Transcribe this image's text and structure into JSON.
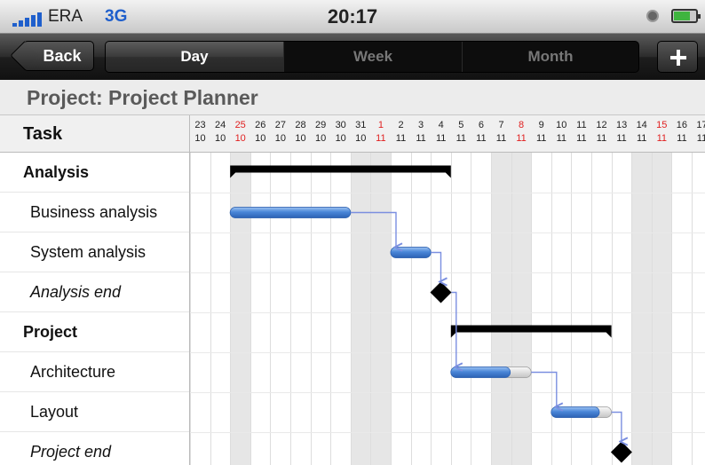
{
  "status_bar": {
    "carrier": "ERA",
    "network": "3G",
    "time": "20:17",
    "icons": [
      "signal-icon",
      "alarm-icon",
      "battery-icon"
    ]
  },
  "navbar": {
    "back_label": "Back",
    "segments": [
      {
        "label": "Day",
        "selected": true
      },
      {
        "label": "Week",
        "selected": false
      },
      {
        "label": "Month",
        "selected": false
      }
    ],
    "add_icon": "plus-icon"
  },
  "project": {
    "title": "Project: Project Planner"
  },
  "task_header": "Task",
  "tasks": [
    {
      "label": "Analysis",
      "style": "group"
    },
    {
      "label": "Business analysis",
      "style": "task"
    },
    {
      "label": "System analysis",
      "style": "task"
    },
    {
      "label": "Analysis end",
      "style": "milestone"
    },
    {
      "label": "Project",
      "style": "group"
    },
    {
      "label": "Architecture",
      "style": "task"
    },
    {
      "label": "Layout",
      "style": "task"
    },
    {
      "label": "Project end",
      "style": "milestone"
    }
  ],
  "timeline": {
    "days": [
      {
        "day": "23",
        "month": "10",
        "weekend": false
      },
      {
        "day": "24",
        "month": "10",
        "weekend": false
      },
      {
        "day": "25",
        "month": "10",
        "weekend": true,
        "holiday": true
      },
      {
        "day": "26",
        "month": "10",
        "weekend": false
      },
      {
        "day": "27",
        "month": "10",
        "weekend": false
      },
      {
        "day": "28",
        "month": "10",
        "weekend": false
      },
      {
        "day": "29",
        "month": "10",
        "weekend": false
      },
      {
        "day": "30",
        "month": "10",
        "weekend": false
      },
      {
        "day": "31",
        "month": "10",
        "weekend": true
      },
      {
        "day": "1",
        "month": "11",
        "weekend": true,
        "holiday": true
      },
      {
        "day": "2",
        "month": "11",
        "weekend": false
      },
      {
        "day": "3",
        "month": "11",
        "weekend": false
      },
      {
        "day": "4",
        "month": "11",
        "weekend": false
      },
      {
        "day": "5",
        "month": "11",
        "weekend": false
      },
      {
        "day": "6",
        "month": "11",
        "weekend": false
      },
      {
        "day": "7",
        "month": "11",
        "weekend": true
      },
      {
        "day": "8",
        "month": "11",
        "weekend": true,
        "holiday": true
      },
      {
        "day": "9",
        "month": "11",
        "weekend": false
      },
      {
        "day": "10",
        "month": "11",
        "weekend": false
      },
      {
        "day": "11",
        "month": "11",
        "weekend": false
      },
      {
        "day": "12",
        "month": "11",
        "weekend": false
      },
      {
        "day": "13",
        "month": "11",
        "weekend": false
      },
      {
        "day": "14",
        "month": "11",
        "weekend": true
      },
      {
        "day": "15",
        "month": "11",
        "weekend": true,
        "holiday": true
      },
      {
        "day": "16",
        "month": "11",
        "weekend": false
      },
      {
        "day": "17",
        "month": "11",
        "weekend": false
      }
    ],
    "bars": [
      {
        "row": 0,
        "type": "summary",
        "start": 2,
        "end": 13
      },
      {
        "row": 1,
        "type": "task",
        "start": 2,
        "end": 8,
        "progress": 1.0
      },
      {
        "row": 2,
        "type": "task",
        "start": 10,
        "end": 12,
        "progress": 1.0
      },
      {
        "row": 3,
        "type": "milestone",
        "at": 12.5
      },
      {
        "row": 4,
        "type": "summary",
        "start": 13,
        "end": 21
      },
      {
        "row": 5,
        "type": "task",
        "start": 13,
        "end": 17,
        "progress": 0.74
      },
      {
        "row": 6,
        "type": "task",
        "start": 18,
        "end": 21,
        "progress": 0.8
      },
      {
        "row": 7,
        "type": "milestone",
        "at": 21.5
      }
    ],
    "links": [
      [
        1,
        2
      ],
      [
        2,
        3
      ],
      [
        3,
        5
      ],
      [
        5,
        6
      ],
      [
        6,
        7
      ]
    ],
    "colors": {
      "bar": "#4a86d8",
      "bar_dark": "#2c62b4",
      "bar_rest": "#e4e4e4",
      "summary": "#000000",
      "milestone": "#000000",
      "link": "#7b8fe0",
      "holiday_text": "#e02020"
    }
  }
}
